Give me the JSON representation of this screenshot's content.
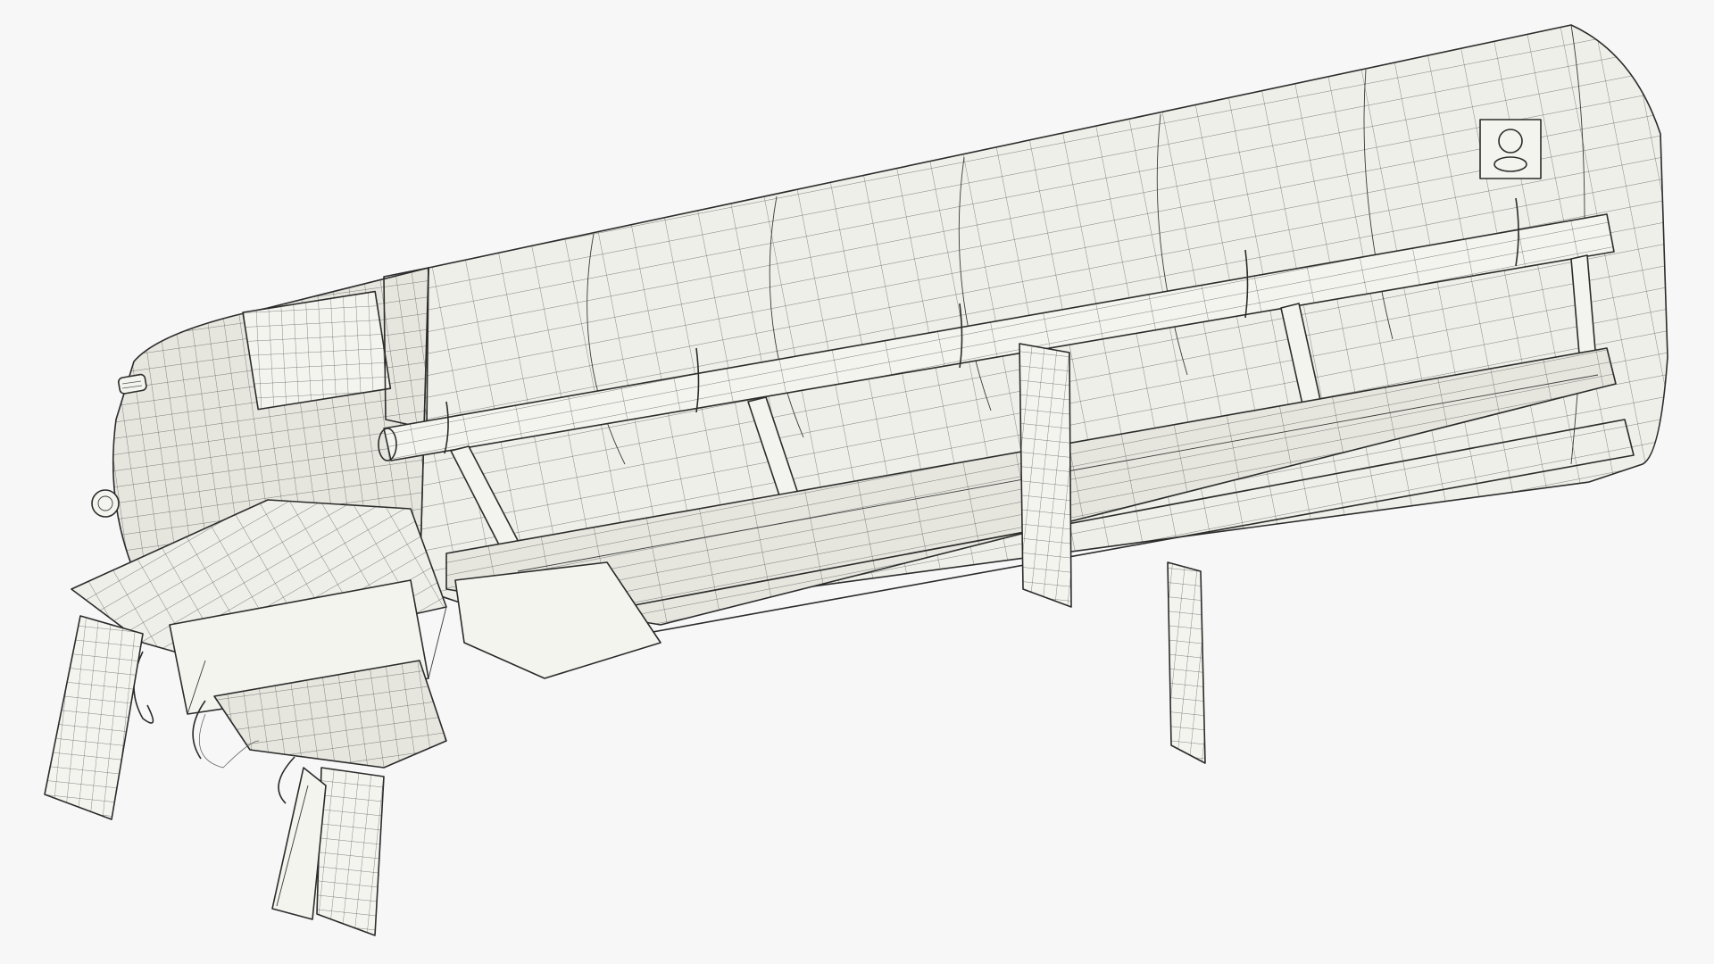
{
  "scene": {
    "subject": "",
    "render_style": "wireframe-over-shaded",
    "background_color": "#f7f7f7",
    "surface_color": "#efefe9",
    "edge_color": "#2b2b2b"
  },
  "icons": {
    "vent": "round-vent-icon",
    "grille": "grille-icon"
  }
}
